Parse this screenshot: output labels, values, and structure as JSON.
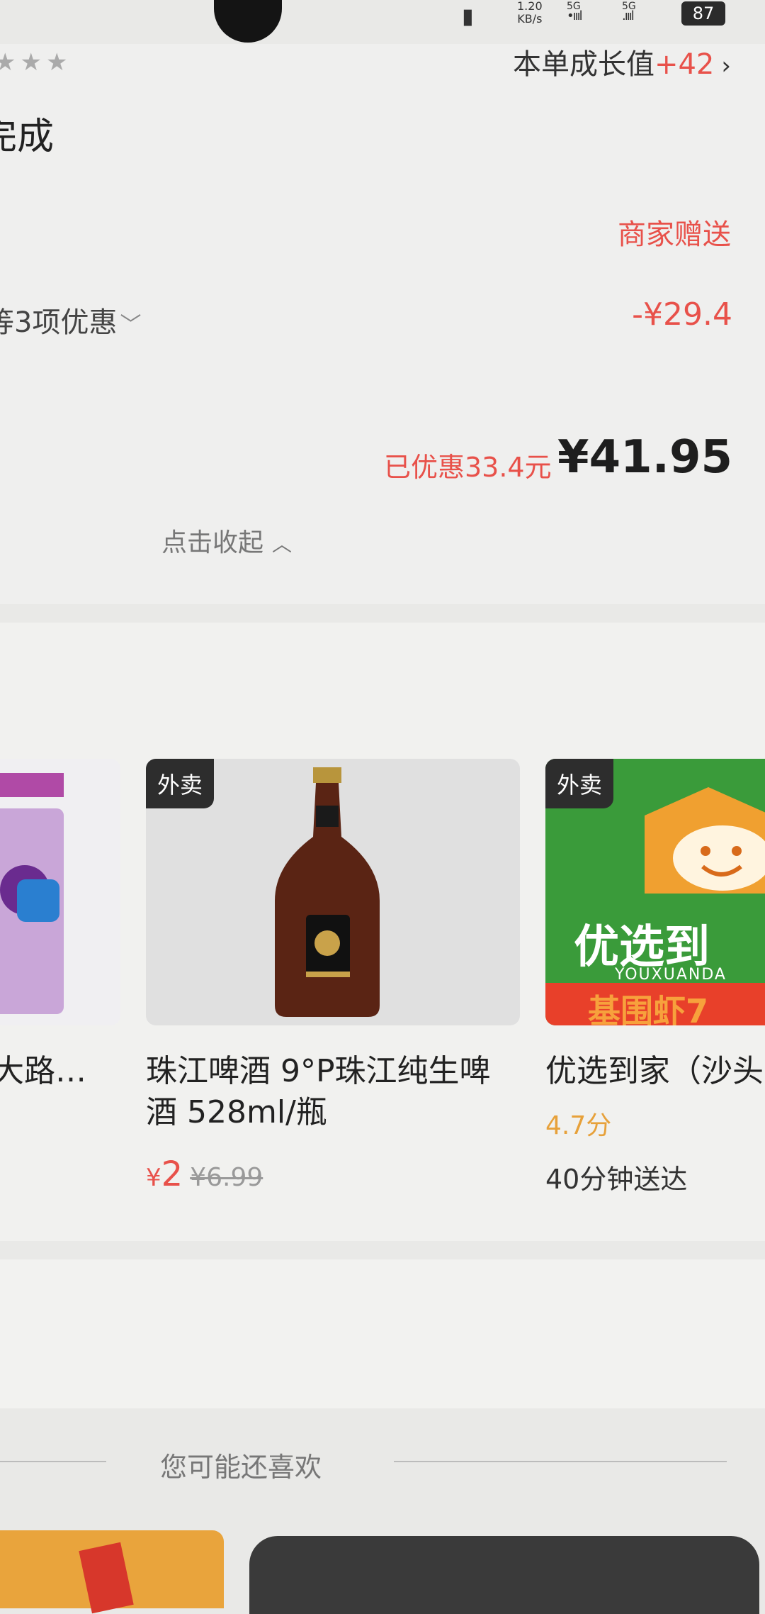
{
  "status_bar": {
    "speed": "1.20",
    "speed_unit": "KB/s",
    "sim1": "5G",
    "sim2": "5G",
    "battery": "87"
  },
  "order": {
    "title_fragment": "完成",
    "merchant_gift": "商家赠送",
    "promo_label": "等3项优惠",
    "discount_amount": "-¥29.4",
    "saved_text": "已优惠33.4元",
    "total_price": "¥41.95",
    "collapse_label": "点击收起"
  },
  "recommendations": {
    "items": [
      {
        "name": "大路…",
        "tag": ""
      },
      {
        "tag": "外卖",
        "name": "珠江啤酒 9°P珠江纯生啤酒 528ml/瓶",
        "currency": "¥",
        "price": "2",
        "original_price": "¥6.99"
      },
      {
        "tag": "外卖",
        "name": "优选到家（沙头",
        "rating": "4.7分",
        "delivery": "40分钟送达",
        "logo_text": "优选到",
        "logo_sub": "YOUXUANDA",
        "banner_text": "基围虾7"
      }
    ]
  },
  "growth": {
    "label": "本单成长值",
    "value": "+42"
  },
  "you_may_like": {
    "title": "您可能还喜欢"
  },
  "colors": {
    "accent": "#e8514a",
    "rating": "#e7a13a",
    "tag_bg": "#2d2d2d"
  }
}
